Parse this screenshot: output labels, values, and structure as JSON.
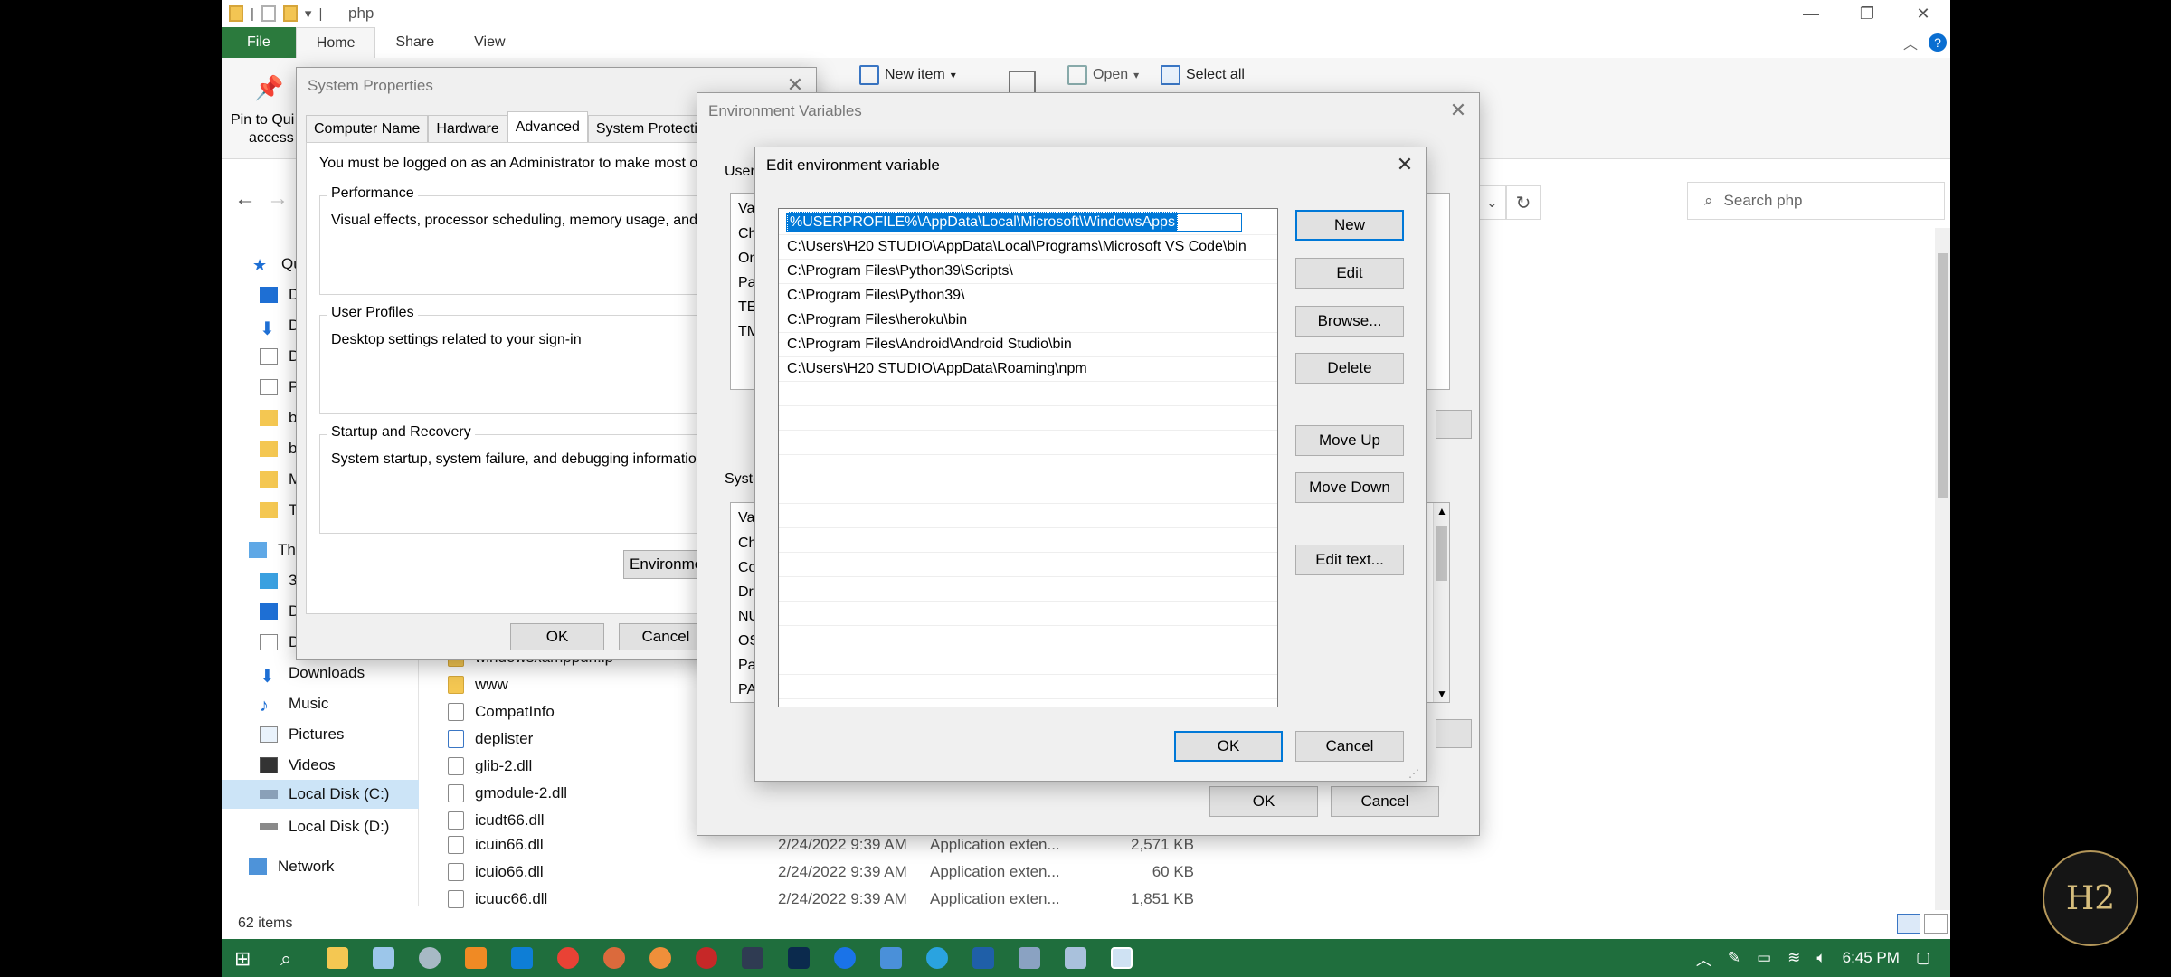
{
  "explorer": {
    "title": "php",
    "ribbon_tabs": [
      "File",
      "Home",
      "Share",
      "View"
    ],
    "ribbon": {
      "pin_label_1": "Pin to Qui",
      "pin_label_2": "access",
      "new_item": "New item",
      "open": "Open",
      "select_all": "Select all"
    },
    "search_placeholder": "Search php",
    "nav": {
      "quick_access": "Qu",
      "q1": "D",
      "q2": "D",
      "q3": "D",
      "q4": "P",
      "q5": "b",
      "q6": "b",
      "q7": "M",
      "q8": "T",
      "this_pc": "Thi",
      "p1": "3",
      "p2": "D",
      "p3": "D",
      "downloads": "Downloads",
      "music": "Music",
      "pictures": "Pictures",
      "videos": "Videos",
      "local_c": "Local Disk (C:)",
      "local_d": "Local Disk (D:)",
      "network": "Network"
    },
    "files": [
      {
        "name": "windowsxamppurl.lp",
        "date": "",
        "type": "",
        "size": ""
      },
      {
        "name": "www",
        "date": "",
        "type": "",
        "size": ""
      },
      {
        "name": "CompatInfo",
        "date": "",
        "type": "",
        "size": ""
      },
      {
        "name": "deplister",
        "date": "",
        "type": "",
        "size": ""
      },
      {
        "name": "glib-2.dll",
        "date": "",
        "type": "",
        "size": ""
      },
      {
        "name": "gmodule-2.dll",
        "date": "",
        "type": "",
        "size": ""
      },
      {
        "name": "icudt66.dll",
        "date": "",
        "type": "",
        "size": ""
      },
      {
        "name": "icuin66.dll",
        "date": "2/24/2022 9:39 AM",
        "type": "Application exten...",
        "size": "2,571 KB"
      },
      {
        "name": "icuio66.dll",
        "date": "2/24/2022 9:39 AM",
        "type": "Application exten...",
        "size": "60 KB"
      },
      {
        "name": "icuuc66.dll",
        "date": "2/24/2022 9:39 AM",
        "type": "Application exten...",
        "size": "1,851 KB"
      }
    ],
    "status": "62 items"
  },
  "system_properties": {
    "title": "System Properties",
    "tabs": [
      "Computer Name",
      "Hardware",
      "Advanced",
      "System Protection"
    ],
    "admin_note": "You must be logged on as an Administrator to make most of th",
    "performance_label": "Performance",
    "performance_text": "Visual effects, processor scheduling, memory usage, and virt",
    "profiles_label": "User Profiles",
    "profiles_text": "Desktop settings related to your sign-in",
    "startup_label": "Startup and Recovery",
    "startup_text": "System startup, system failure, and debugging information",
    "env_button": "Environmen",
    "ok": "OK",
    "cancel": "Cancel"
  },
  "env_vars": {
    "title": "Environment Variables",
    "user_label": "User",
    "user_rows": [
      "Va",
      "Ch",
      "On",
      "Pa",
      "TE",
      "TM"
    ],
    "system_label": "Syste",
    "system_rows": [
      "Va",
      "Ch",
      "Co",
      "Dr",
      "NU",
      "OS",
      "Pa",
      "PA"
    ],
    "ok": "OK",
    "cancel": "Cancel"
  },
  "edit_env": {
    "title": "Edit environment variable",
    "entries": [
      "%USERPROFILE%\\AppData\\Local\\Microsoft\\WindowsApps",
      "C:\\Users\\H20 STUDIO\\AppData\\Local\\Programs\\Microsoft VS Code\\bin",
      "C:\\Program Files\\Python39\\Scripts\\",
      "C:\\Program Files\\Python39\\",
      "C:\\Program Files\\heroku\\bin",
      "C:\\Program Files\\Android\\Android Studio\\bin",
      "C:\\Users\\H20 STUDIO\\AppData\\Roaming\\npm"
    ],
    "buttons": {
      "new": "New",
      "edit": "Edit",
      "browse": "Browse...",
      "delete": "Delete",
      "move_up": "Move Up",
      "move_down": "Move Down",
      "edit_text": "Edit text...",
      "ok": "OK",
      "cancel": "Cancel"
    }
  },
  "taskbar": {
    "time": "6:45 PM"
  },
  "watermark": "H2"
}
